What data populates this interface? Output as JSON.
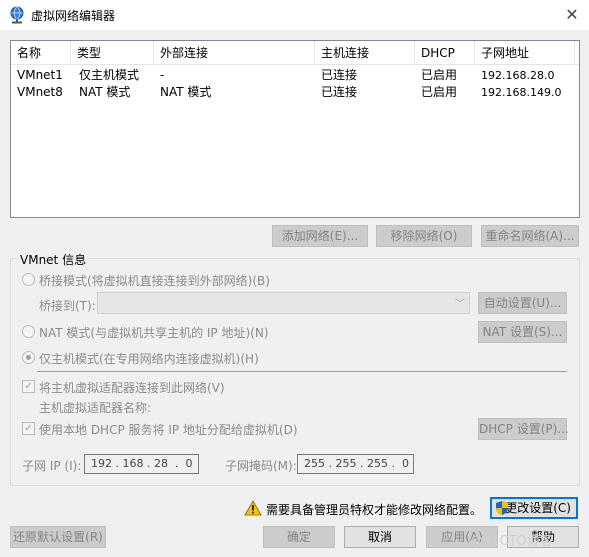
{
  "window": {
    "title": "虚拟网络编辑器",
    "close_glyph": "✕"
  },
  "table": {
    "columns": [
      "名称",
      "类型",
      "外部连接",
      "主机连接",
      "DHCP",
      "子网地址"
    ],
    "rows": [
      {
        "name": "VMnet1",
        "type": "仅主机模式",
        "external": "-",
        "host": "已连接",
        "dhcp": "已启用",
        "subnet": "192.168.28.0"
      },
      {
        "name": "VMnet8",
        "type": "NAT 模式",
        "external": "NAT 模式",
        "host": "已连接",
        "dhcp": "已启用",
        "subnet": "192.168.149.0"
      }
    ]
  },
  "table_buttons": {
    "add": "添加网络(E)...",
    "remove": "移除网络(O)",
    "rename": "重命名网络(A)..."
  },
  "vmnet_info": {
    "group_label": "VMnet 信息",
    "bridge_mode": "桥接模式(将虚拟机直接连接到外部网络)(B)",
    "bridge_to_label": "桥接到(T):",
    "bridge_to_value": "",
    "auto_settings": "自动设置(U)...",
    "nat_mode": "NAT 模式(与虚拟机共享主机的 IP 地址)(N)",
    "nat_settings": "NAT 设置(S)...",
    "host_only_mode": "仅主机模式(在专用网络内连接虚拟机)(H)",
    "selected_mode": "host_only",
    "connect_adapter": "将主机虚拟适配器连接到此网络(V)",
    "connect_adapter_checked": true,
    "adapter_name_label": "主机虚拟适配器名称:",
    "adapter_name_value": "",
    "use_dhcp": "使用本地 DHCP 服务将 IP 地址分配给虚拟机(D)",
    "use_dhcp_checked": true,
    "dhcp_settings": "DHCP 设置(P)...",
    "subnet_ip_label": "子网 IP (I):",
    "subnet_ip_value": "192 . 168 . 28  .  0",
    "subnet_mask_label": "子网掩码(M):",
    "subnet_mask_value": "255 . 255 . 255 .  0"
  },
  "footer": {
    "admin_notice": "需要具备管理员特权才能修改网络配置。",
    "change_settings": "更改设置(C)",
    "restore_defaults": "还原默认设置(R)",
    "ok": "确定",
    "cancel": "取消",
    "apply": "应用(A)",
    "help": "帮助"
  },
  "watermark": "@51CTO博客",
  "colors": {
    "accent": "#0078d7",
    "warning": "#f5c400",
    "disabled_text": "#838383"
  }
}
